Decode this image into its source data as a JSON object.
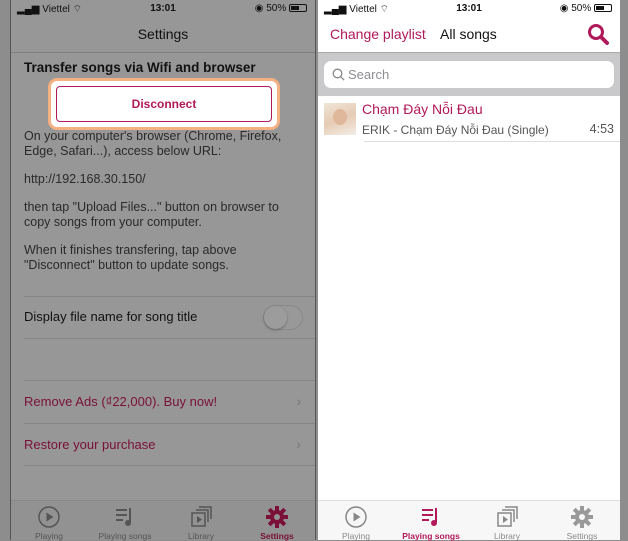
{
  "status": {
    "carrier": "Viettel",
    "time": "13:01",
    "battery": "50%"
  },
  "settings": {
    "title": "Settings",
    "section_title": "Transfer songs via Wifi and browser",
    "disconnect_label": "Disconnect",
    "instructions": [
      "On your computer's browser (Chrome, Firefox,",
      "Edge, Safari...), access below URL:",
      "http://192.168.30.150/",
      "then tap \"Upload Files...\" button on browser to",
      "copy songs from your computer.",
      "When it finishes transfering, tap above",
      "\"Disconnect\" button to update songs."
    ],
    "toggle_label": "Display file name for song title",
    "toggle_on": false,
    "remove_ads": "Remove Ads (₫22,000). Buy now!",
    "restore": "Restore your purchase"
  },
  "songs": {
    "change_playlist": "Change playlist",
    "title": "All songs",
    "search_placeholder": "Search",
    "items": [
      {
        "title": "Chạm Đáy Nỗi Đau",
        "subtitle": "ERIK - Chạm Đáy Nỗi Đau (Single)",
        "duration": "4:53"
      }
    ]
  },
  "tabs": [
    "Playing",
    "Playing songs",
    "Library",
    "Settings"
  ],
  "colors": {
    "accent": "#b0195a",
    "accent_dim": "#7a1038"
  }
}
